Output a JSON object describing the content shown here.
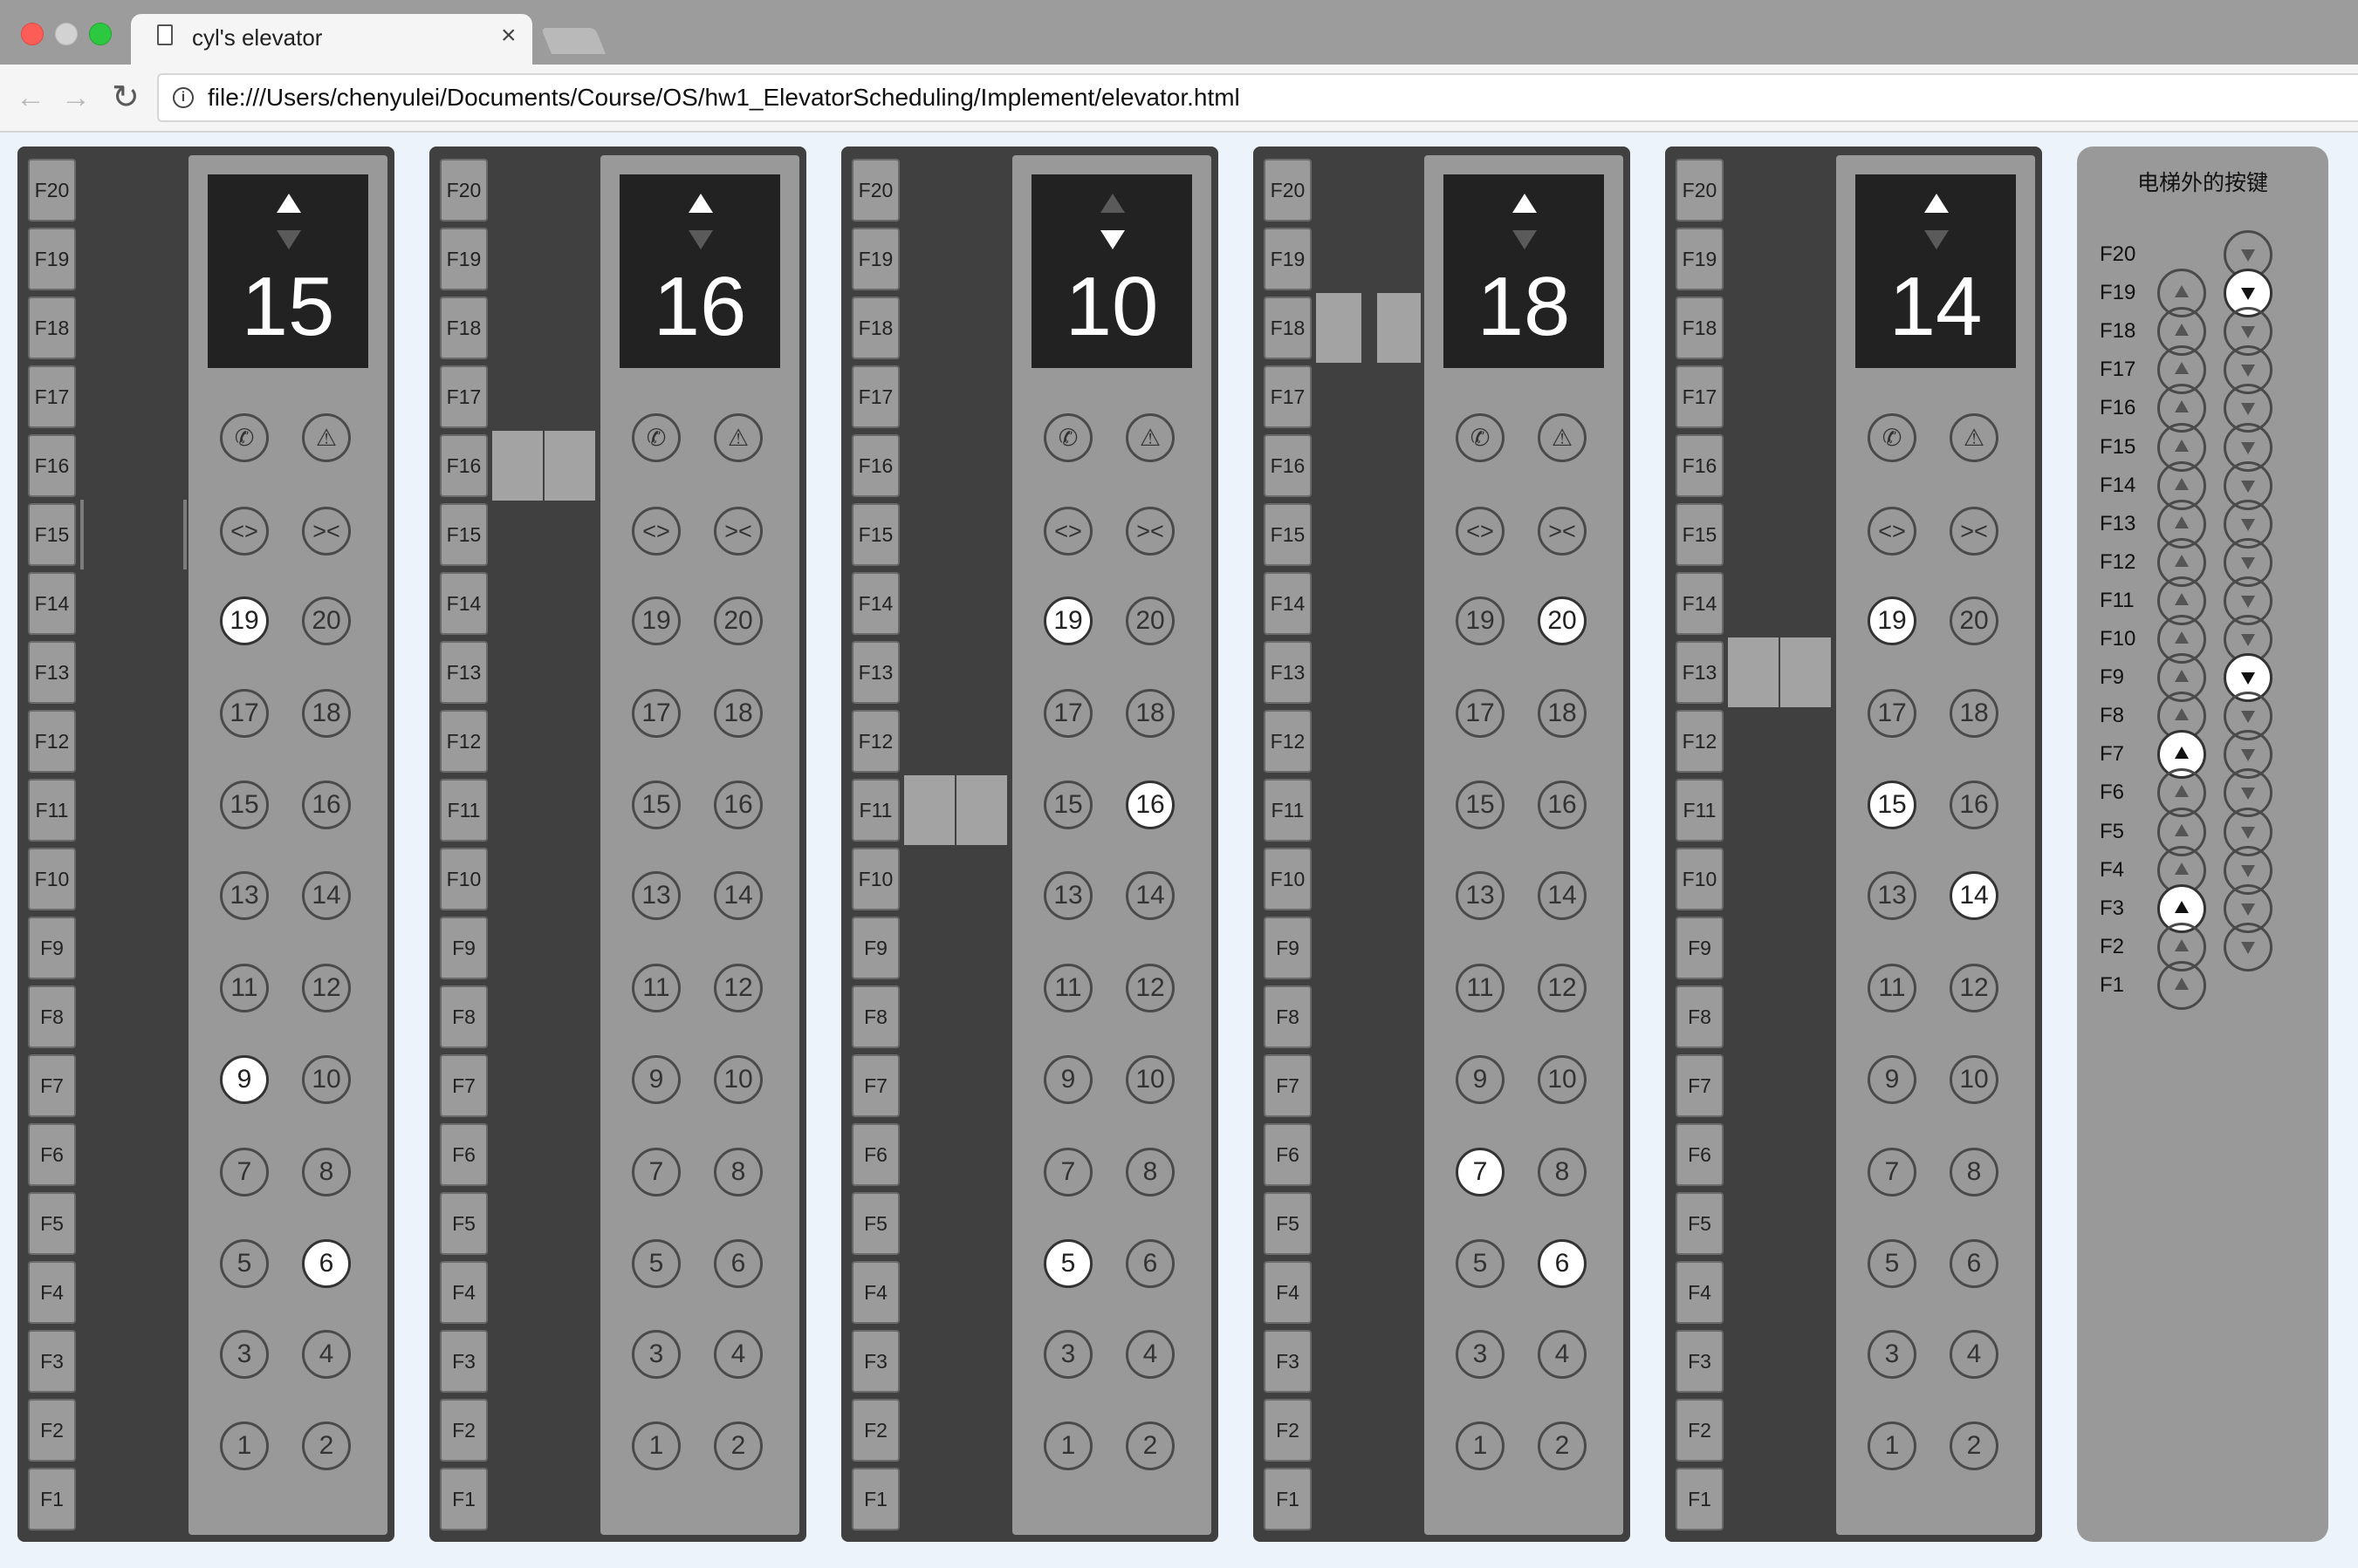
{
  "browser": {
    "tab_title": "cyl's elevator",
    "tab_close": "×",
    "url": "file:///Users/chenyulei/Documents/Course/OS/hw1_ElevatorScheduling/Implement/elevator.html",
    "back": "←",
    "forward": "→",
    "reload": "↻",
    "info": "i"
  },
  "elevators": [
    {
      "floor": "15",
      "up": true,
      "down": false,
      "car_floor": 15,
      "doors": "open",
      "lit": [
        "19",
        "9",
        "6"
      ]
    },
    {
      "floor": "16",
      "up": true,
      "down": false,
      "car_floor": 16,
      "doors": "closed",
      "lit": []
    },
    {
      "floor": "10",
      "up": false,
      "down": true,
      "car_floor": 11,
      "doors": "closed",
      "lit": [
        "19",
        "16",
        "5"
      ]
    },
    {
      "floor": "18",
      "up": true,
      "down": false,
      "car_floor": 18,
      "doors": "open",
      "lit": [
        "20",
        "7",
        "6"
      ]
    },
    {
      "floor": "14",
      "up": true,
      "down": false,
      "car_floor": 13,
      "doors": "closed",
      "lit": [
        "19",
        "15",
        "14"
      ]
    }
  ],
  "floor_labels": [
    "F20",
    "F19",
    "F18",
    "F17",
    "F16",
    "F15",
    "F14",
    "F13",
    "F12",
    "F11",
    "F10",
    "F9",
    "F8",
    "F7",
    "F6",
    "F5",
    "F4",
    "F3",
    "F2",
    "F1"
  ],
  "panel_buttons": [
    [
      "✆",
      "⚠"
    ],
    [
      "<>",
      "><"
    ],
    [
      "19",
      "20"
    ],
    [
      "17",
      "18"
    ],
    [
      "15",
      "16"
    ],
    [
      "13",
      "14"
    ],
    [
      "11",
      "12"
    ],
    [
      "9",
      "10"
    ],
    [
      "7",
      "8"
    ],
    [
      "5",
      "6"
    ],
    [
      "3",
      "4"
    ],
    [
      "1",
      "2"
    ]
  ],
  "hall": {
    "title": "电梯外的按键",
    "rows": [
      {
        "label": "F20",
        "up": null,
        "down": false
      },
      {
        "label": "F19",
        "up": false,
        "down": true
      },
      {
        "label": "F18",
        "up": false,
        "down": false
      },
      {
        "label": "F17",
        "up": false,
        "down": false
      },
      {
        "label": "F16",
        "up": false,
        "down": false
      },
      {
        "label": "F15",
        "up": false,
        "down": false
      },
      {
        "label": "F14",
        "up": false,
        "down": false
      },
      {
        "label": "F13",
        "up": false,
        "down": false
      },
      {
        "label": "F12",
        "up": false,
        "down": false
      },
      {
        "label": "F11",
        "up": false,
        "down": false
      },
      {
        "label": "F10",
        "up": false,
        "down": false
      },
      {
        "label": "F9",
        "up": false,
        "down": true
      },
      {
        "label": "F8",
        "up": false,
        "down": false
      },
      {
        "label": "F7",
        "up": true,
        "down": false
      },
      {
        "label": "F6",
        "up": false,
        "down": false
      },
      {
        "label": "F5",
        "up": false,
        "down": false
      },
      {
        "label": "F4",
        "up": false,
        "down": false
      },
      {
        "label": "F3",
        "up": true,
        "down": false
      },
      {
        "label": "F2",
        "up": false,
        "down": false
      },
      {
        "label": "F1",
        "up": false,
        "down": null
      }
    ]
  }
}
